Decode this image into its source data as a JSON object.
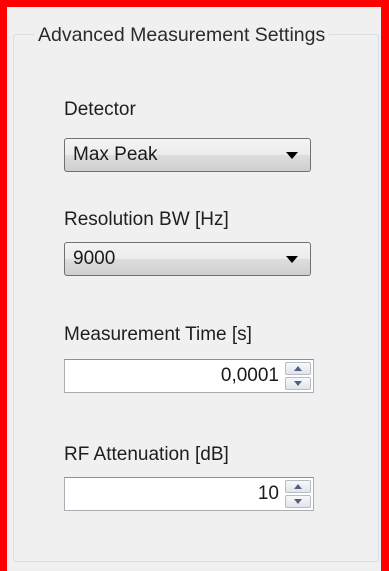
{
  "group": {
    "title": "Advanced Measurement Settings"
  },
  "detector": {
    "label": "Detector",
    "value": "Max Peak"
  },
  "resolution_bw": {
    "label": "Resolution BW [Hz]",
    "value": "9000"
  },
  "measurement_time": {
    "label": "Measurement Time [s]",
    "value": "0,0001"
  },
  "rf_attenuation": {
    "label": "RF Attenuation [dB]",
    "value": "10"
  },
  "icons": {
    "dropdown": "chevron-down-icon",
    "spin_up": "spin-up-icon",
    "spin_down": "spin-down-icon"
  },
  "colors": {
    "frame_border": "#ff0000",
    "panel_background": "#f0f0f0",
    "spin_arrow": "#4d6185"
  }
}
